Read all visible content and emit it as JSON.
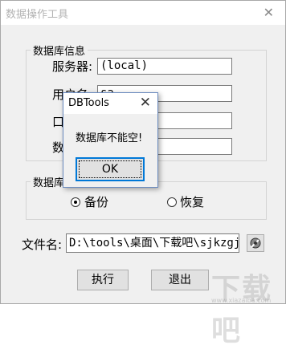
{
  "window": {
    "title": "数据操作工具",
    "close_glyph": "✕"
  },
  "db_info": {
    "legend": "数据库信息",
    "server_label": "服务器:",
    "server_value": "(local)",
    "user_label": "用户名",
    "user_value": "sa",
    "password_label": "口",
    "dbname_label": "数"
  },
  "operation": {
    "legend": "数据库操",
    "backup_label": "备份",
    "restore_label": "恢复",
    "selected": "backup"
  },
  "file": {
    "label": "文件名:",
    "value": "D:\\tools\\桌面\\下载吧\\sjkzgj"
  },
  "buttons": {
    "execute": "执行",
    "exit": "退出"
  },
  "dialog": {
    "title": "DBTools",
    "close_glyph": "✕",
    "message": "数据库不能空!",
    "ok_label": "OK"
  },
  "watermark": {
    "text": "下载吧",
    "sub": "www.xiazaiba.com"
  }
}
